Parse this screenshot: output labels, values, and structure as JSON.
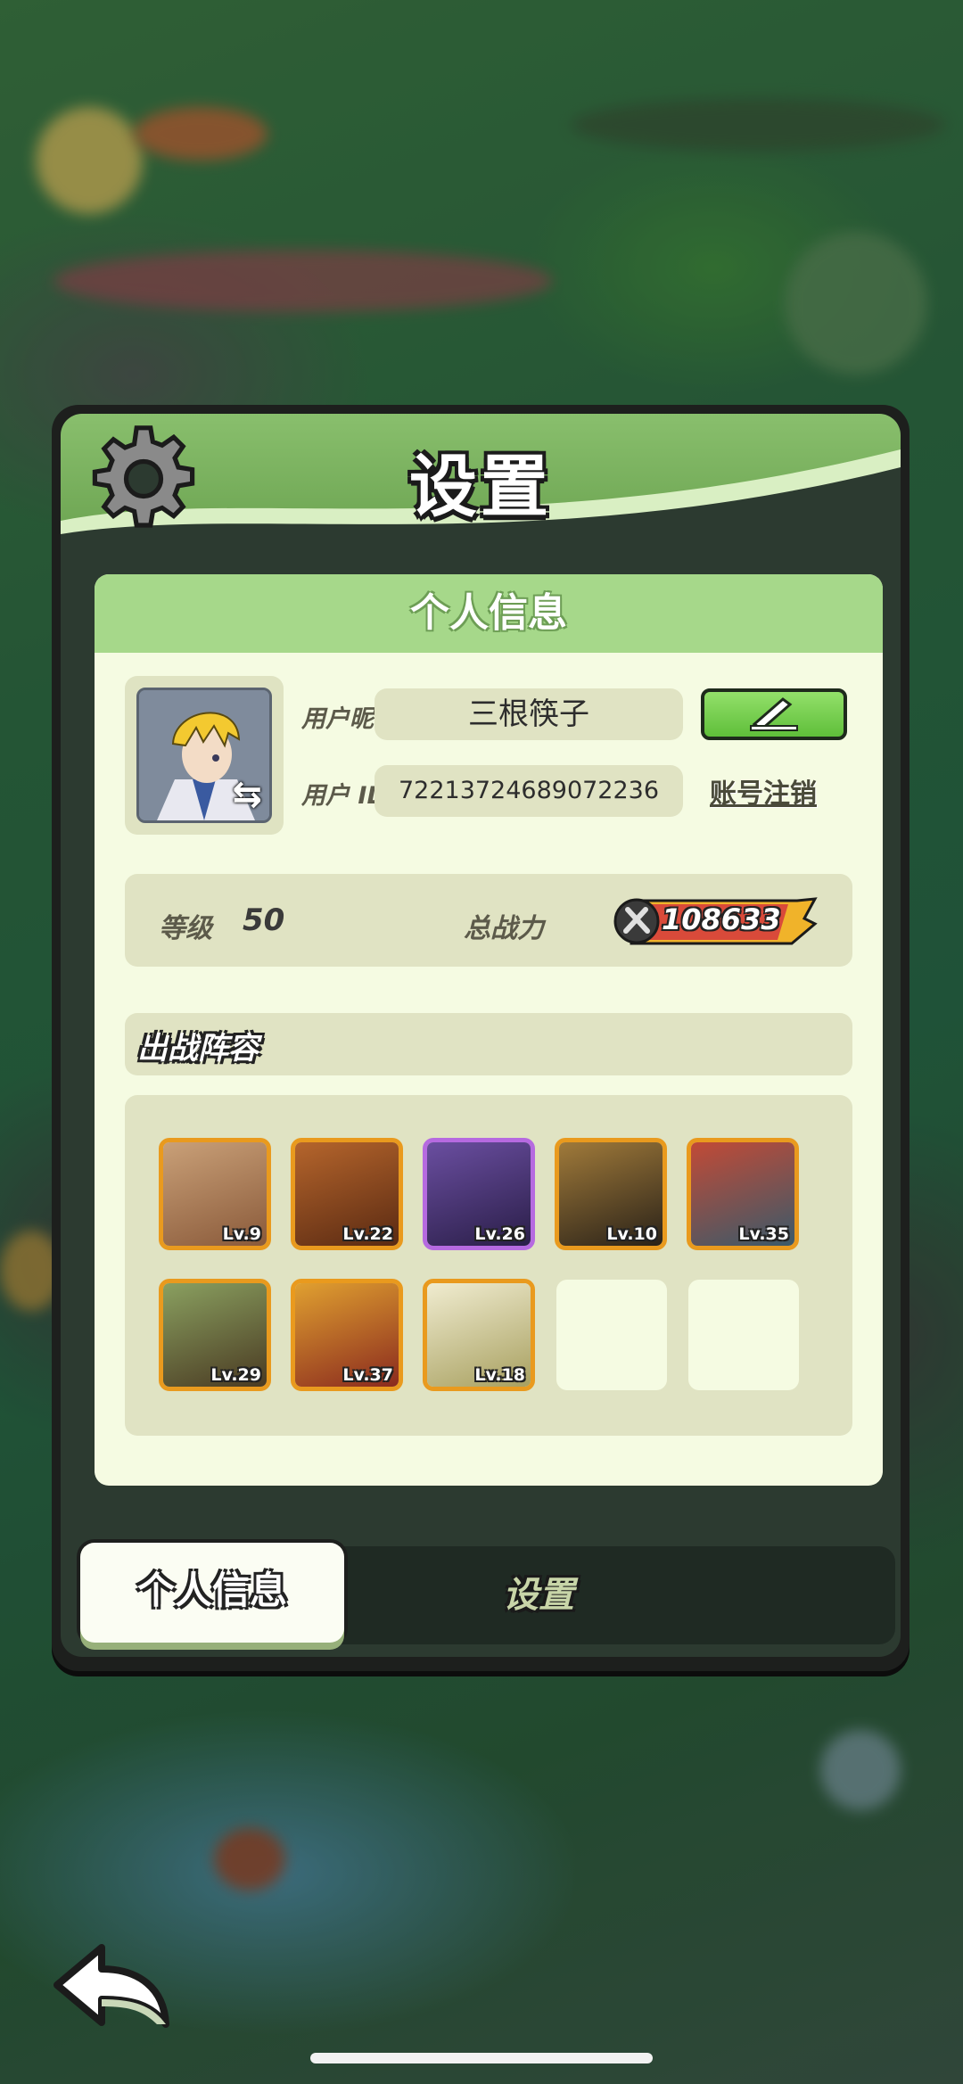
{
  "dialog": {
    "title": "设置",
    "gear_icon": "gear-icon"
  },
  "profile": {
    "section_title": "个人信息",
    "nickname_label": "用户昵称",
    "nickname": "三根筷子",
    "id_label": "用户 ID",
    "user_id": "72213724689072236",
    "logout_label": "账号注销",
    "edit_icon": "pencil-icon",
    "swap_icon": "swap-icon"
  },
  "stats": {
    "level_label": "等级",
    "level": "50",
    "power_label": "总战力",
    "power": "108633",
    "power_icon": "crossed-swords-icon"
  },
  "team": {
    "title": "出战阵容",
    "heroes": [
      {
        "level": "Lv.9",
        "rarity": "legendary",
        "color": "#b88a6a"
      },
      {
        "level": "Lv.22",
        "rarity": "legendary",
        "color": "#8a4a26"
      },
      {
        "level": "Lv.26",
        "rarity": "epic",
        "color": "#4e3a78"
      },
      {
        "level": "Lv.10",
        "rarity": "legendary",
        "color": "#6a5a3a"
      },
      {
        "level": "Lv.35",
        "rarity": "legendary",
        "color": "#9a3a2a"
      },
      {
        "level": "Lv.29",
        "rarity": "legendary",
        "color": "#6a7a4a"
      },
      {
        "level": "Lv.37",
        "rarity": "legendary",
        "color": "#8a2a1e"
      },
      {
        "level": "Lv.18",
        "rarity": "legendary",
        "color": "#d8c88a"
      }
    ],
    "empty_slots": 2
  },
  "tabs": {
    "profile": "个人信息",
    "settings": "设置"
  },
  "colors": {
    "header_green": "#89bf6d",
    "panel_bg": "#f5fbe2",
    "field_bg": "#e0e3c3",
    "legendary_border": "#e99a1e",
    "epic_border": "#b66ae0"
  },
  "back_icon": "back-arrow-icon"
}
